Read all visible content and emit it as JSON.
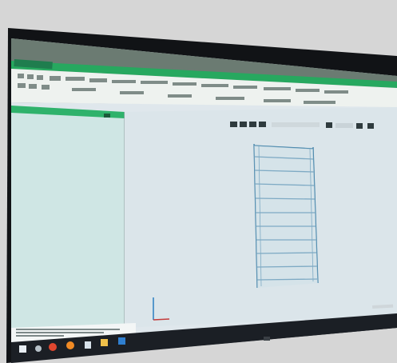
{
  "photo": {
    "subject": "photo-of-monitor",
    "app": {
      "ribbon_tabs": [
        "",
        "",
        "",
        "",
        "",
        "",
        ""
      ],
      "file_tab_label": "",
      "left_panel_header": "",
      "status_text": "",
      "grid_label": ""
    },
    "taskbar": {
      "icons": [
        "windows-icon",
        "search-icon",
        "chrome-icon",
        "firefox-icon",
        "pin-icon",
        "folder-icon",
        "app-icon"
      ]
    },
    "colors": {
      "ribbon": "#1f7d4e",
      "ribbon_light": "#2bb36a",
      "panel_bg": "#cfe5e3",
      "canvas_bg": "#dde6ea",
      "drawing_line": "#3d7fa6",
      "taskbar": "#1b1f25"
    }
  }
}
